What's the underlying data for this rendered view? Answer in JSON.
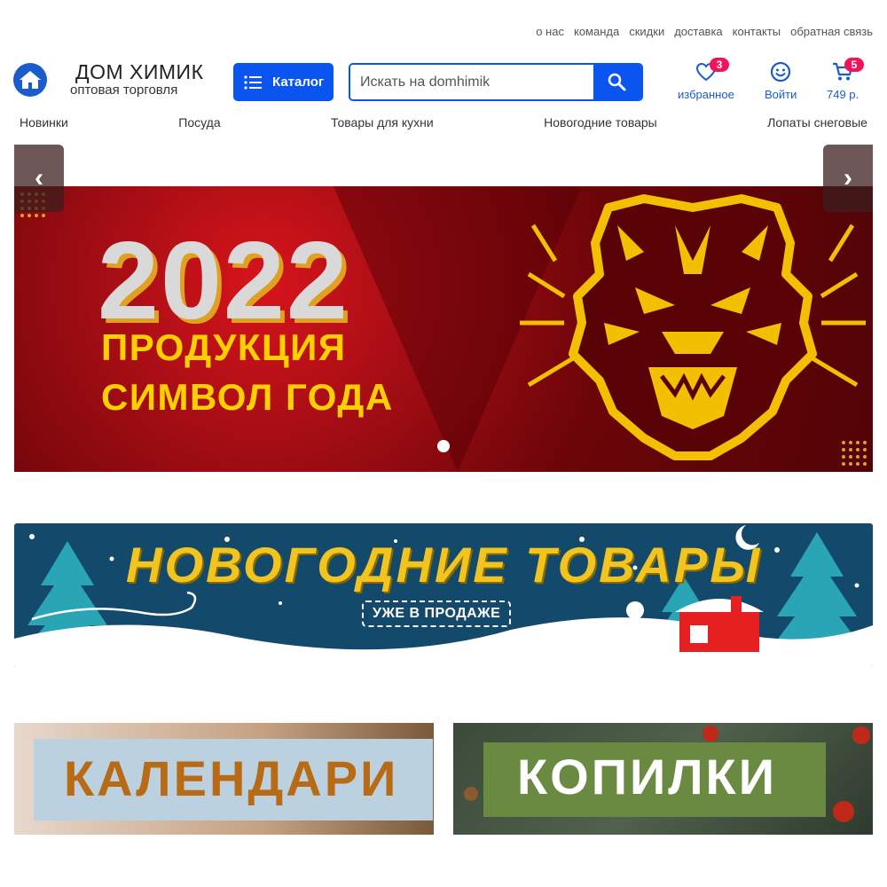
{
  "top_links": [
    "о нас",
    "команда",
    "скидки",
    "доставка",
    "контакты",
    "обратная связь"
  ],
  "logo": {
    "title": "ДОМ ХИМИК",
    "subtitle": "оптовая торговля"
  },
  "catalog_label": "Каталог",
  "search": {
    "placeholder": "Искать на domhimik"
  },
  "header_icons": {
    "favorites": {
      "label": "избранное",
      "count": "3"
    },
    "login": {
      "label": "Войти"
    },
    "cart": {
      "label": "749 р.",
      "count": "5"
    }
  },
  "nav": [
    "Новинки",
    "Посуда",
    "Товары для кухни",
    "Новогодние товары",
    "Лопаты снеговые"
  ],
  "hero": {
    "year": "2022",
    "line1": "ПРОДУКЦИЯ",
    "line2": "СИМВОЛ ГОДА",
    "prev": "‹",
    "next": "›"
  },
  "ny_banner": {
    "title": "НОВОГОДНИЕ ТОВАРЫ",
    "subtitle": "УЖЕ В ПРОДАЖЕ"
  },
  "cards": [
    {
      "title": "КАЛЕНДАРИ"
    },
    {
      "title": "КОПИЛКИ"
    }
  ],
  "colors": {
    "brand_blue": "#0a55f0",
    "badge": "#f0145a",
    "hero_yellow": "#ffd000"
  }
}
